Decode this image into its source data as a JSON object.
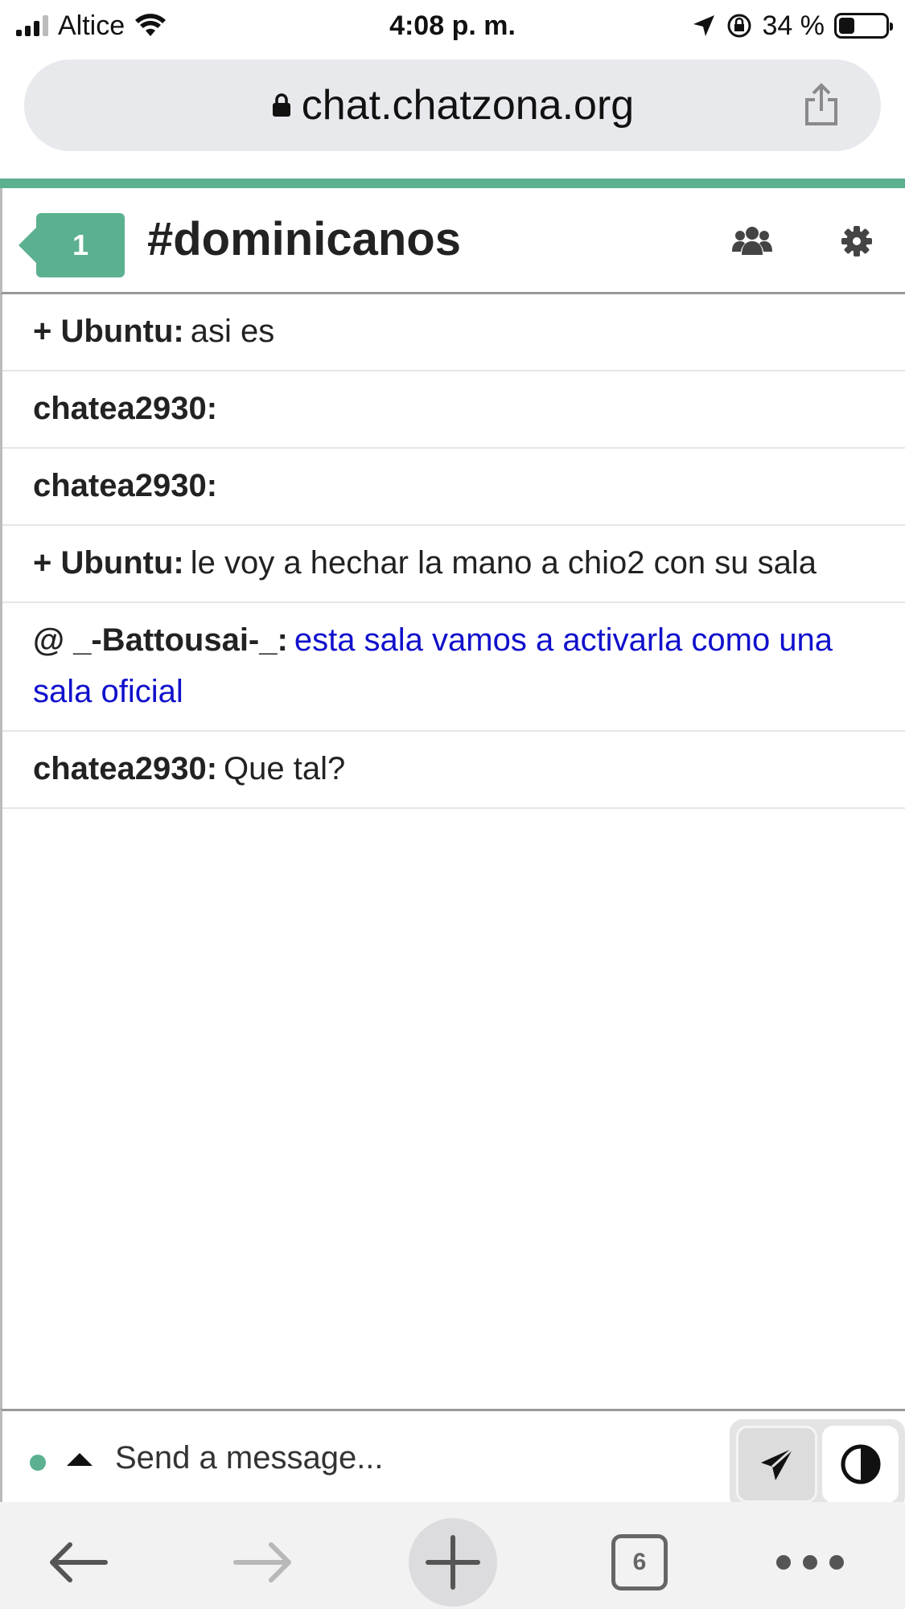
{
  "status_bar": {
    "carrier": "Altice",
    "time": "4:08 p. m.",
    "battery_percent": "34 %",
    "battery_level": 0.34
  },
  "browser": {
    "url": "chat.chatzona.org",
    "tabs_count": "6"
  },
  "chat": {
    "unread_badge": "1",
    "channel": "#dominicanos",
    "accent_color": "#5bb08f",
    "messages": [
      {
        "nick": "+ Ubuntu:",
        "text": "asi es",
        "color": "#222222"
      },
      {
        "nick": "chatea2930:",
        "text": "",
        "color": "#222222"
      },
      {
        "nick": "chatea2930:",
        "text": "",
        "color": "#222222"
      },
      {
        "nick": "+ Ubuntu:",
        "text": "le voy a hechar la mano a chio2 con su sala",
        "color": "#222222"
      },
      {
        "nick": "@ _-Battousai-_:",
        "text": "esta sala vamos a activarla como una sala oficial",
        "color": "#1010cc"
      },
      {
        "nick": "chatea2930:",
        "text": "Que tal?",
        "color": "#222222"
      }
    ],
    "input": {
      "placeholder": "Send a message...",
      "value": ""
    }
  },
  "icons": {
    "users": "users-icon",
    "settings": "gear-icon",
    "send": "send-icon",
    "theme": "contrast-icon",
    "back": "back-arrow-icon",
    "forward": "forward-arrow-icon",
    "new_tab": "plus-icon",
    "more": "more-dots-icon",
    "share": "share-icon",
    "lock": "lock-icon"
  }
}
